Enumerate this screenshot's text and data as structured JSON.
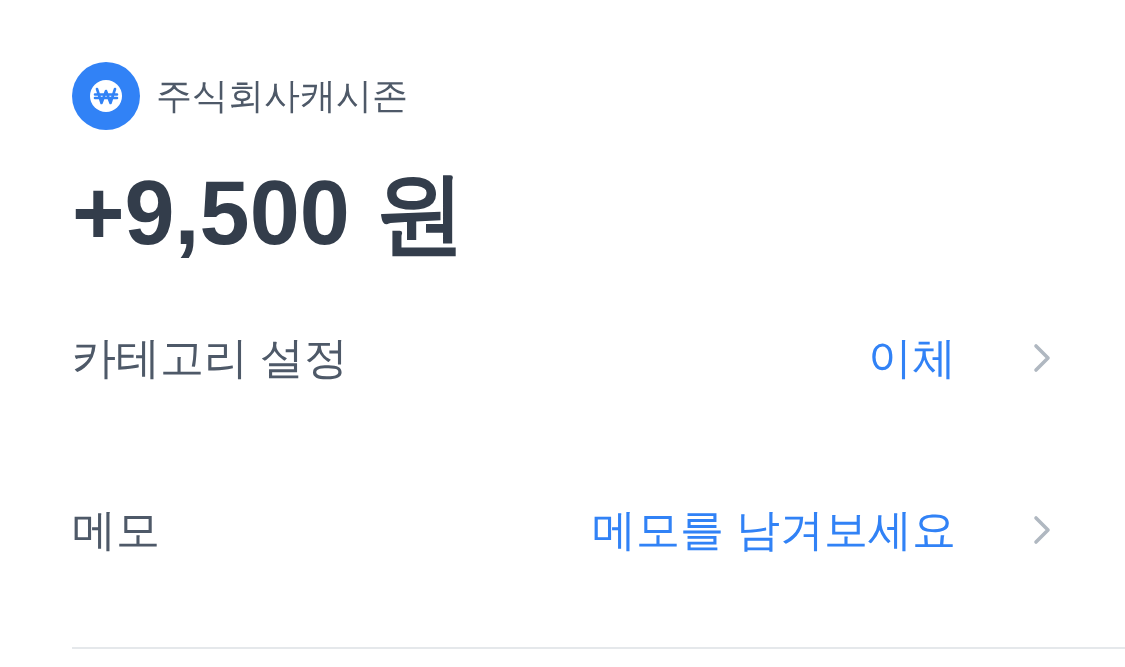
{
  "merchant": {
    "name": "주식회사캐시존"
  },
  "amount": "+9,500 원",
  "rows": [
    {
      "label": "카테고리 설정",
      "value": "이체"
    },
    {
      "label": "메모",
      "placeholder": "메모를 남겨보세요"
    }
  ]
}
